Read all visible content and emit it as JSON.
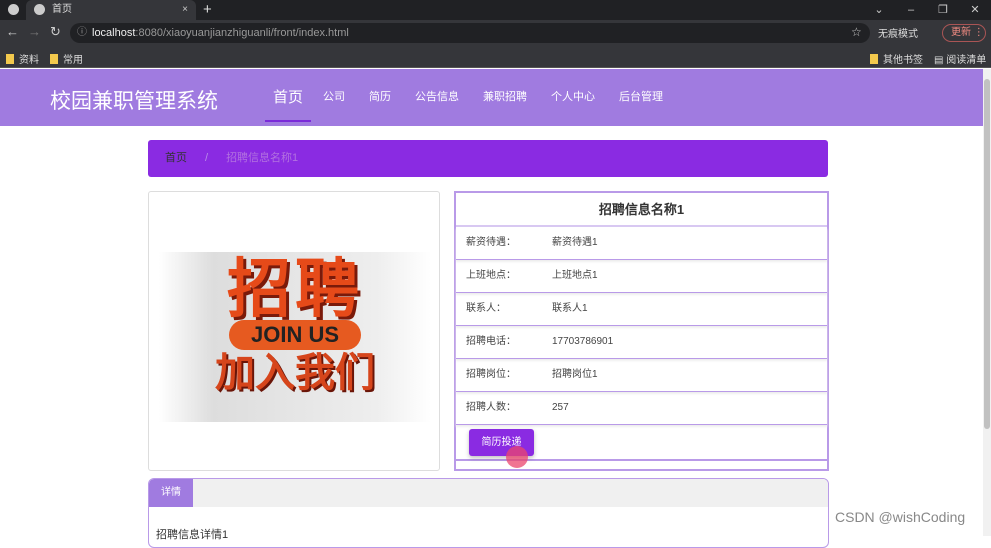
{
  "browser": {
    "tab_title": "首页",
    "close": "×",
    "new_tab": "+",
    "url_host": "localhost",
    "url_rest": ":8080/xiaoyuanjianzhiguanli/front/index.html",
    "incognito": "无痕模式",
    "update": "更新",
    "bookmarks": [
      "资料",
      "常用"
    ],
    "other_bookmarks": "其他书签",
    "reading_list": "阅读清单",
    "win": [
      "⌄",
      "–",
      "❐",
      "✕"
    ]
  },
  "header": {
    "brand": "校园兼职管理系统",
    "menu": [
      "首页",
      "公司",
      "简历",
      "公告信息",
      "兼职招聘",
      "个人中心",
      "后台管理"
    ]
  },
  "breadcrumb": {
    "home": "首页",
    "sep": "/",
    "current": "招聘信息名称1"
  },
  "poster": {
    "line1": "招聘",
    "line2": "JOIN US",
    "line3": "加入我们"
  },
  "info": {
    "title": "招聘信息名称1",
    "rows": [
      {
        "label": "薪资待遇：",
        "value": "薪资待遇1"
      },
      {
        "label": "上班地点：",
        "value": "上班地点1"
      },
      {
        "label": "联系人：",
        "value": "联系人1"
      },
      {
        "label": "招聘电话：",
        "value": "17703786901"
      },
      {
        "label": "招聘岗位：",
        "value": "招聘岗位1"
      },
      {
        "label": "招聘人数：",
        "value": "257"
      }
    ],
    "button": "简历投递"
  },
  "detail": {
    "tab": "详情",
    "content": "招聘信息详情1"
  },
  "watermark": "CSDN @wishCoding"
}
